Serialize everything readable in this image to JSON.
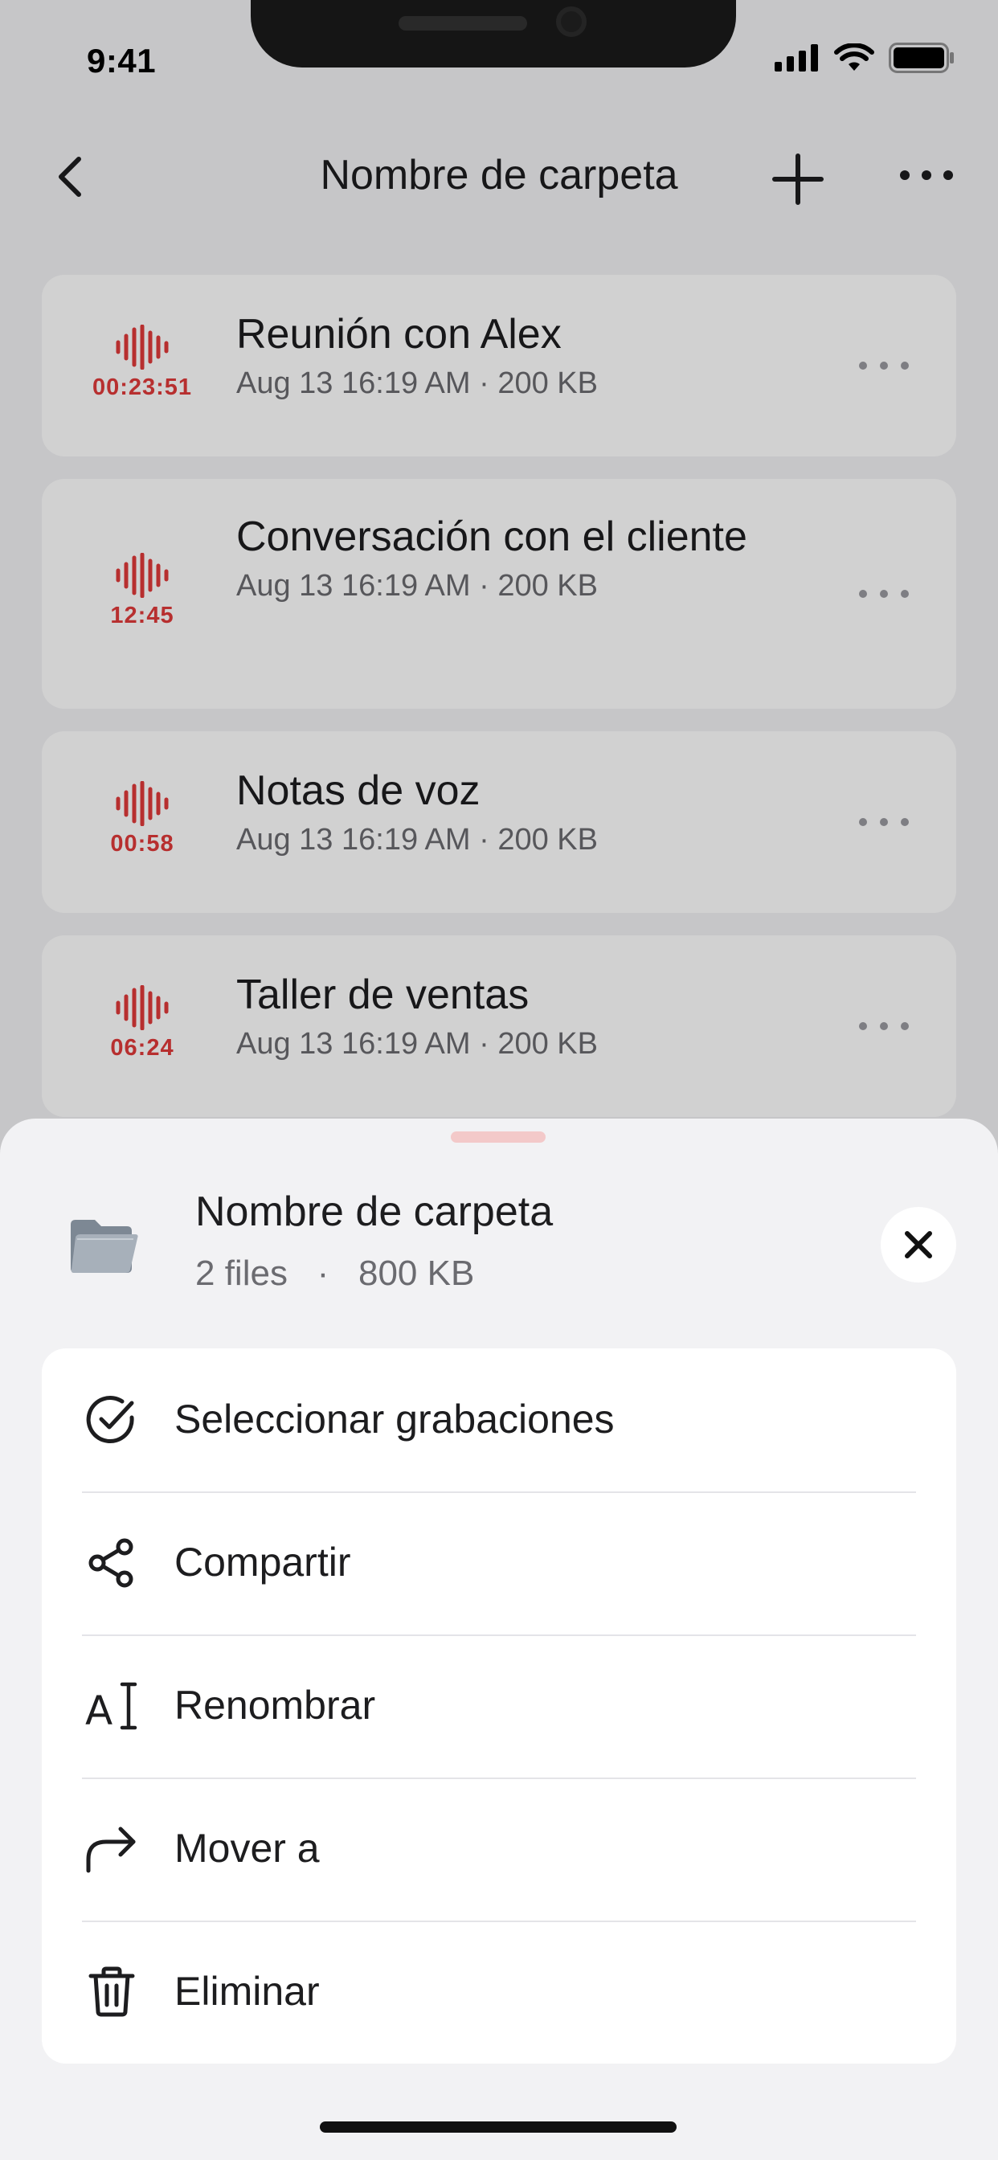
{
  "status": {
    "time": "9:41"
  },
  "nav": {
    "title": "Nombre de carpeta"
  },
  "recordings": [
    {
      "title": "Reunión con Alex",
      "duration": "00:23:51",
      "meta": "Aug 13 16:19 AM · 200 KB"
    },
    {
      "title": "Conversación con el cliente",
      "duration": "12:45",
      "meta": "Aug 13 16:19 AM · 200 KB"
    },
    {
      "title": "Notas de voz",
      "duration": "00:58",
      "meta": "Aug 13 16:19 AM · 200 KB"
    },
    {
      "title": "Taller de ventas",
      "duration": "06:24",
      "meta": "Aug 13 16:19 AM · 200 KB"
    }
  ],
  "sheet": {
    "folder_name": "Nombre de carpeta",
    "files": "2 files",
    "size": "800 KB",
    "separator": "·",
    "actions": [
      {
        "label": "Seleccionar grabaciones",
        "icon": "check-circle-icon"
      },
      {
        "label": "Compartir",
        "icon": "share-icon"
      },
      {
        "label": "Renombrar",
        "icon": "rename-icon"
      },
      {
        "label": "Mover a",
        "icon": "forward-arrow-icon"
      },
      {
        "label": "Eliminar",
        "icon": "trash-icon"
      }
    ]
  },
  "colors": {
    "accent_red": "#e03a3a",
    "background": "#f2f2f4",
    "card": "#ffffff",
    "text_primary": "#1d1d1f",
    "text_secondary": "#6b6b70"
  }
}
